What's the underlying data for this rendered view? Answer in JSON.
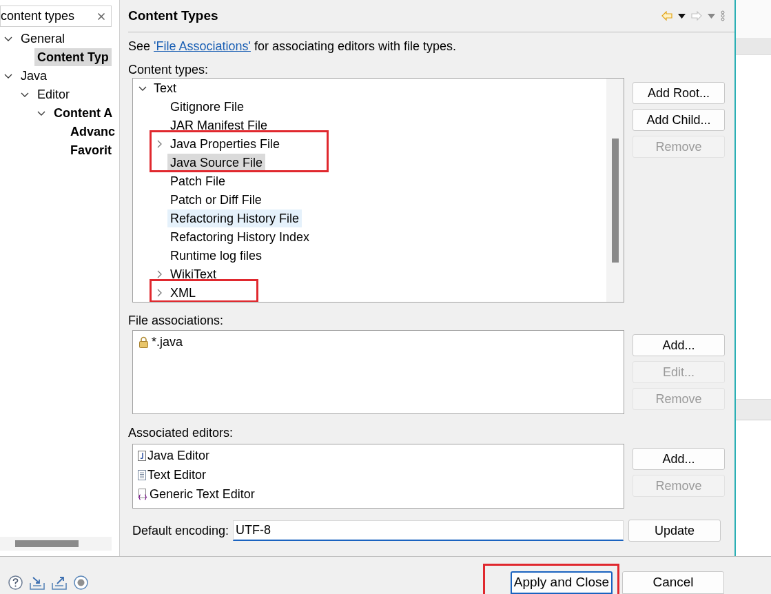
{
  "filter": {
    "value": "content types"
  },
  "nav_tree": [
    {
      "label": "General",
      "expanded": true,
      "match": false,
      "selected": false,
      "children": [
        {
          "label": "Content Typ",
          "match": true,
          "selected": true
        }
      ]
    },
    {
      "label": "Java",
      "expanded": true,
      "match": false,
      "selected": false,
      "children": [
        {
          "label": "Editor",
          "expanded": true,
          "match": false,
          "selected": false,
          "children": [
            {
              "label": "Content A",
              "expanded": true,
              "match": true,
              "selected": false,
              "children": [
                {
                  "label": "Advanc",
                  "match": true,
                  "selected": false
                },
                {
                  "label": "Favorit",
                  "match": true,
                  "selected": false
                }
              ]
            }
          ]
        }
      ]
    }
  ],
  "page": {
    "title": "Content Types",
    "intro_before": "See ",
    "intro_link": "'File Associations'",
    "intro_after": " for associating editors with file types."
  },
  "content_types": {
    "label": "Content types:",
    "tree": [
      {
        "label": "Text",
        "kind": "branch",
        "expanded": true,
        "selected": false,
        "highlighted": false,
        "annotated": false,
        "children": [
          {
            "label": "Gitignore File",
            "kind": "leaf",
            "selected": false,
            "highlighted": false,
            "annotated": false
          },
          {
            "label": "JAR Manifest File",
            "kind": "leaf",
            "selected": false,
            "highlighted": false,
            "annotated": false
          },
          {
            "label": "Java Properties File",
            "kind": "branch",
            "expanded": false,
            "selected": false,
            "highlighted": false,
            "annotated": true
          },
          {
            "label": "Java Source File",
            "kind": "leaf",
            "selected": true,
            "highlighted": false,
            "annotated": true
          },
          {
            "label": "Patch File",
            "kind": "leaf",
            "selected": false,
            "highlighted": false,
            "annotated": false
          },
          {
            "label": "Patch or Diff File",
            "kind": "leaf",
            "selected": false,
            "highlighted": false,
            "annotated": false
          },
          {
            "label": "Refactoring History File",
            "kind": "leaf",
            "selected": false,
            "highlighted": true,
            "annotated": false
          },
          {
            "label": "Refactoring History Index",
            "kind": "leaf",
            "selected": false,
            "highlighted": false,
            "annotated": false
          },
          {
            "label": "Runtime log files",
            "kind": "leaf",
            "selected": false,
            "highlighted": false,
            "annotated": false
          },
          {
            "label": "WikiText",
            "kind": "branch",
            "expanded": false,
            "selected": false,
            "highlighted": false,
            "annotated": false
          },
          {
            "label": "XML",
            "kind": "branch",
            "expanded": false,
            "selected": false,
            "highlighted": false,
            "annotated": true
          }
        ]
      }
    ],
    "buttons": [
      {
        "label": "Add Root...",
        "disabled": false
      },
      {
        "label": "Add Child...",
        "disabled": false
      },
      {
        "label": "Remove",
        "disabled": true
      }
    ]
  },
  "file_associations": {
    "label": "File associations:",
    "items": [
      {
        "label": "*.java",
        "kind": "locked"
      }
    ],
    "buttons": [
      {
        "label": "Add...",
        "disabled": false
      },
      {
        "label": "Edit...",
        "disabled": true
      },
      {
        "label": "Remove",
        "disabled": true
      }
    ]
  },
  "associated_editors": {
    "label": "Associated editors:",
    "items": [
      {
        "label": "Java Editor",
        "kind": "java"
      },
      {
        "label": "Text Editor",
        "kind": "text"
      },
      {
        "label": "Generic Text Editor",
        "kind": "generic"
      }
    ],
    "buttons": [
      {
        "label": "Add...",
        "disabled": false
      },
      {
        "label": "Remove",
        "disabled": true
      }
    ]
  },
  "encoding": {
    "label": "Default encoding:",
    "value": "UTF-8",
    "button": {
      "label": "Update",
      "disabled": false
    }
  },
  "footer": {
    "buttons": [
      {
        "label": "Apply and Close",
        "default": true,
        "annotated": true
      },
      {
        "label": "Cancel",
        "default": false,
        "annotated": false
      }
    ]
  }
}
